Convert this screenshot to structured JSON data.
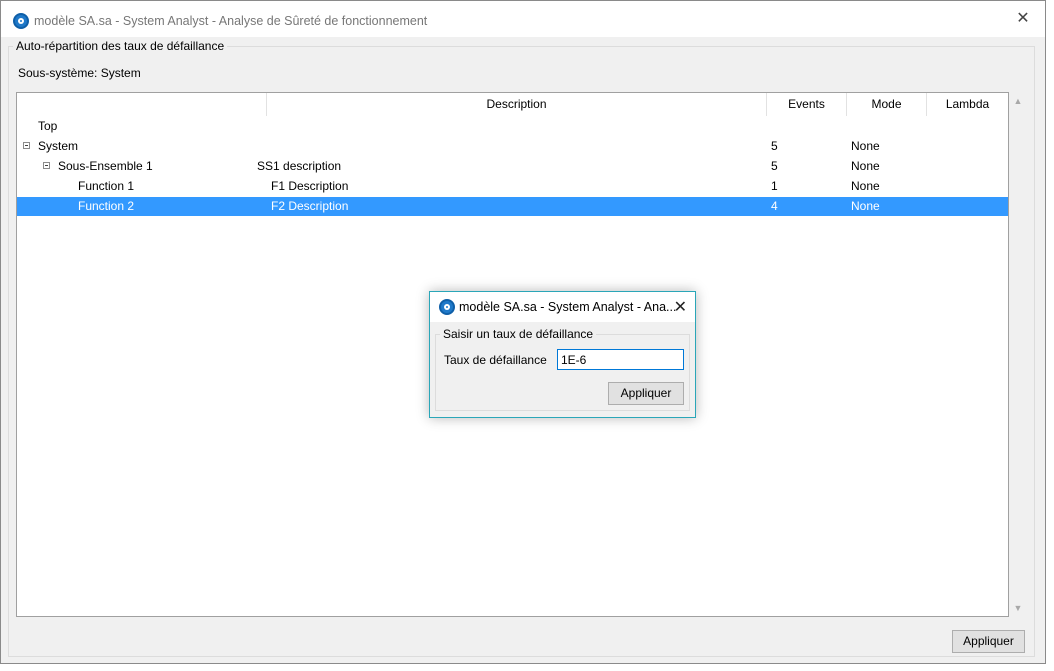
{
  "window": {
    "title": "modèle SA.sa - System Analyst - Analyse de Sûreté de fonctionnement",
    "close_glyph": "✕"
  },
  "group": {
    "legend": "Auto-répartition des taux de défaillance",
    "subsystem_label": "Sous-système: System"
  },
  "table": {
    "columns": [
      "",
      "Description",
      "Events",
      "Mode",
      "Lambda"
    ],
    "rows": [
      {
        "name": "Top",
        "description": "",
        "events": "",
        "mode": "",
        "lambda": ""
      },
      {
        "name": "System",
        "description": "",
        "events": "5",
        "mode": "None",
        "lambda": ""
      },
      {
        "name": "Sous-Ensemble 1",
        "description": "SS1 description",
        "events": "5",
        "mode": "None",
        "lambda": ""
      },
      {
        "name": "Function 1",
        "description": "F1 Description",
        "events": "1",
        "mode": "None",
        "lambda": ""
      },
      {
        "name": "Function 2",
        "description": "F2 Description",
        "events": "4",
        "mode": "None",
        "lambda": ""
      }
    ],
    "selected_row": "Function 2"
  },
  "footer": {
    "apply_label": "Appliquer"
  },
  "dialog": {
    "title": "modèle SA.sa - System Analyst - Ana...",
    "close_glyph": "✕",
    "group_legend": "Saisir un taux de défaillance",
    "rate_label": "Taux de défaillance",
    "rate_value": "1E-6",
    "apply_label": "Appliquer"
  },
  "colors": {
    "selection": "#3399ff",
    "dialog_border": "#2aa6b8",
    "input_focus": "#0078d7",
    "app_icon": "#1f79c9"
  }
}
